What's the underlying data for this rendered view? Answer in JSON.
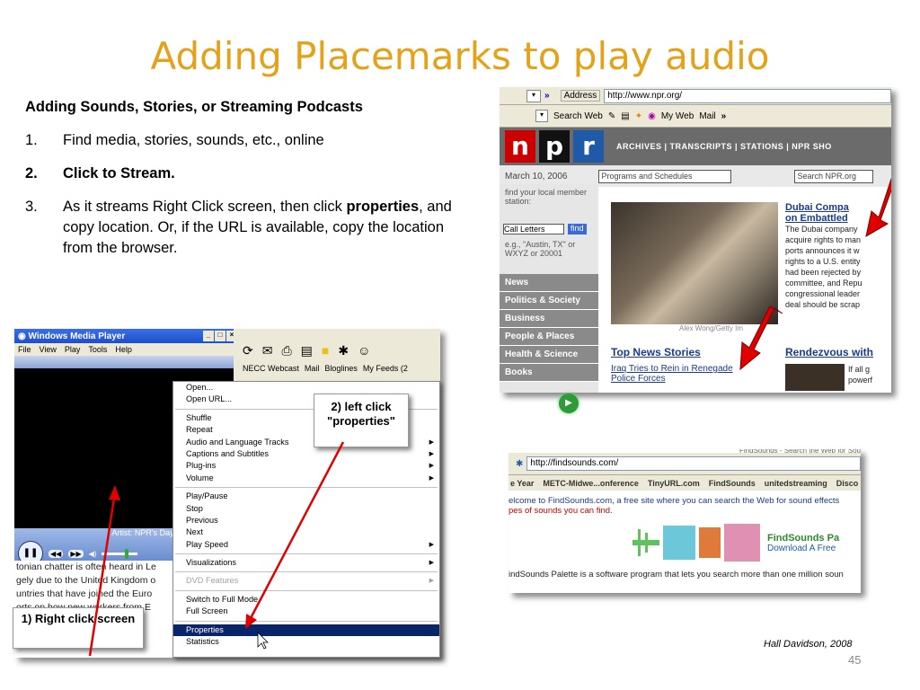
{
  "slide": {
    "title": "Adding Placemarks to play audio",
    "heading": "Adding Sounds, Stories, or Streaming Podcasts",
    "steps": [
      {
        "num": "1.",
        "text": "Find media, stories, sounds, etc., online"
      },
      {
        "num": "2.",
        "text": "Click to Stream."
      },
      {
        "num": "3.",
        "pre": "As it streams Right Click screen, then click ",
        "bold": "properties",
        "post": ", and copy location.  Or, if the URL is available, copy the location from the browser."
      }
    ],
    "credit": "Hall Davidson, 2008",
    "page_number": "45"
  },
  "npr_screenshot": {
    "address_label": "Address",
    "url": "http://www.npr.org/",
    "toolbar": {
      "search": "Search Web",
      "myweb": "My Web",
      "mail": "Mail"
    },
    "logo": [
      "n",
      "p",
      "r"
    ],
    "nav": "ARCHIVES  |  TRANSCRIPTS  |  STATIONS  |  NPR SHO",
    "date": "March 10, 2006",
    "dropdown": "Programs and Schedules",
    "search_box": "Search NPR.org",
    "station_finder": "find your local member station:",
    "call_letters": "Call Letters",
    "find_button": "find",
    "example": "e.g., \"Austin, TX\" or WXYZ or 20001",
    "sections": [
      "News",
      "Politics & Society",
      "Business",
      "People & Places",
      "Health & Science",
      "Books"
    ],
    "photo_credit": "Alex Wong/Getty Im",
    "headline1": "Dubai Compa",
    "headline1b": "on Embattled",
    "story_text": [
      "The Dubai company",
      "acquire rights to man",
      "ports announces it w",
      "rights to a U.S. entity",
      "had been rejected by",
      "committee, and Repu",
      "congressional leader",
      "deal should be scrap"
    ],
    "top_news": "Top News Stories",
    "top_link1": "Iraq Tries to Rein in Renegade",
    "top_link2": "Police Forces",
    "rendezvous": "Rendezvous with",
    "rendezvous_text": [
      "If all g",
      "powerf"
    ]
  },
  "findsounds_screenshot": {
    "top_text": "FindSounds - Search the Web for Sou",
    "url": "http://findsounds.com/",
    "links": [
      "e Year",
      "METC-Midwe...onference",
      "TinyURL.com",
      "FindSounds",
      "unitedstreaming",
      "Disco"
    ],
    "welcome": "elcome to FindSounds.com, a free site where you can search the Web for sound effects",
    "welcome2": "pes of sounds you can find.",
    "palette": "FindSounds Pa",
    "download": "Download A Free",
    "footer": "indSounds Palette is a software program that lets you search more than one million soun"
  },
  "wmp_screenshot": {
    "window_title": "Windows Media Player",
    "menu": [
      "File",
      "View",
      "Play",
      "Tools",
      "Help"
    ],
    "artist": "Artist: NPR's Day to Day - Thursd",
    "links_bar": [
      "NECC Webcast",
      "Mail",
      "Bloglines",
      "My Feeds (2"
    ],
    "article": [
      "tonian chatter is often heard in Le",
      "gely due to the United Kingdom o",
      "untries that have joined the Euro",
      "orts on how new workers from E"
    ],
    "context_menu": [
      {
        "label": "Open...",
        "arrow": false
      },
      {
        "label": "Open URL...",
        "arrow": false
      },
      {
        "sep": true
      },
      {
        "label": "Shuffle",
        "arrow": false
      },
      {
        "label": "Repeat",
        "arrow": false
      },
      {
        "label": "Audio and Language Tracks",
        "arrow": true
      },
      {
        "label": "Captions and Subtitles",
        "arrow": true
      },
      {
        "label": "Plug-ins",
        "arrow": true
      },
      {
        "label": "Volume",
        "arrow": true
      },
      {
        "sep": true
      },
      {
        "label": "Play/Pause",
        "arrow": false
      },
      {
        "label": "Stop",
        "arrow": false
      },
      {
        "label": "Previous",
        "arrow": false
      },
      {
        "label": "Next",
        "arrow": false
      },
      {
        "label": "Play Speed",
        "arrow": true
      },
      {
        "sep": true
      },
      {
        "label": "Visualizations",
        "arrow": true
      },
      {
        "sep": true
      },
      {
        "label": "DVD Features",
        "arrow": true,
        "disabled": true
      },
      {
        "sep": true
      },
      {
        "label": "Switch to Full Mode",
        "arrow": false
      },
      {
        "label": "Full Screen",
        "arrow": false
      },
      {
        "sep": true
      },
      {
        "label": "Properties",
        "arrow": false,
        "highlight": true
      },
      {
        "label": "Statistics",
        "arrow": false
      }
    ]
  },
  "callouts": {
    "left_click": "2) left click \"properties\"",
    "right_click": "1) Right click screen"
  },
  "colors": {
    "title": "#e3a21a",
    "arrow": "#e00000",
    "npr_red": "#cc0000",
    "npr_blue": "#1f5aa8"
  }
}
